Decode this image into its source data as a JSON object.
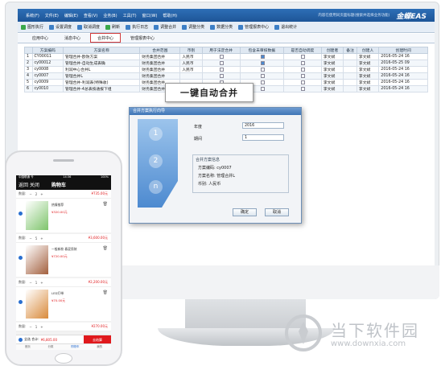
{
  "app": {
    "menu": [
      "系统(F)",
      "文件(E)",
      "编辑(E)",
      "查看(V)",
      "业务(B)",
      "工具(T)",
      "窗口(W)",
      "帮助(H)"
    ],
    "menu_hint": "内容在使用同页面标题(搜索并选择业务功能)",
    "logo": "金蝶EAS",
    "toolbar": [
      "图形执行",
      "设置调度",
      "取消调度",
      "刷新",
      "执行日志",
      "调整合并",
      "调整分类",
      "数据分类",
      "管理报表中心",
      "退出统计"
    ],
    "tabs": [
      "应用中心",
      "消息中心",
      "合并中心",
      "管理报表中心"
    ],
    "active_tab": "合并中心"
  },
  "grid": {
    "columns": [
      "",
      "方案编码",
      "方案名称",
      "合并范围",
      "币别",
      "用于法定合并",
      "包含未审核数据",
      "是否自动调度",
      "创建者",
      "备注",
      "创建人",
      "创建时间"
    ],
    "rows": [
      [
        "1",
        "CY00011",
        "管理合并-欧防方案",
        "财务集团合并",
        "人民币",
        false,
        true,
        false,
        "李文斌",
        "",
        "李文斌",
        "2016-05-24 16"
      ],
      [
        "2",
        "cy00012",
        "管理合并-自动生成表确",
        "财务集团合并",
        "人民币",
        false,
        true,
        false,
        "李文斌",
        "",
        "李文斌",
        "2016-05-25 09"
      ],
      [
        "3",
        "cy0008",
        "利润中心合并L",
        "财务集团合并",
        "人民币",
        false,
        false,
        false,
        "李文斌",
        "",
        "李文斌",
        "2016-05-24 16"
      ],
      [
        "4",
        "cy0007",
        "管理合并L",
        "财务集团合并",
        "",
        false,
        false,
        false,
        "李文斌",
        "",
        "李文斌",
        "2016-05-24 16"
      ],
      [
        "5",
        "cy0009",
        "管理合并-利润表(特殊收)",
        "财务集团合并",
        "",
        false,
        false,
        false,
        "李文斌",
        "",
        "李文斌",
        "2016-05-24 16"
      ],
      [
        "6",
        "cy0010",
        "管理合并-4总表按通报下组",
        "财务集团合并",
        "人民币",
        false,
        false,
        false,
        "李文斌",
        "",
        "李文斌",
        "2016-05-24 16"
      ]
    ]
  },
  "callout": "一键自动合并",
  "dialog": {
    "title": "合并方案执行向导",
    "year_label": "年度",
    "year_value": "2016",
    "period_label": "期间",
    "period_value": "1",
    "group_title": "合并方案信息",
    "scheme_code": "方案编码: cy0007",
    "scheme_name": "方案名称: 管理合并L",
    "currency": "币别: 人民币",
    "ok": "确定",
    "cancel": "取消",
    "steps": [
      "1",
      "2",
      "n"
    ]
  },
  "phone": {
    "status_left": "中国联通 令",
    "status_time": "14:36",
    "status_right": "100%",
    "back": "返回 关闭",
    "title": "购物车",
    "items": [
      {
        "qty_label": "数量:",
        "qty": "2",
        "sum": "¥735.00元",
        "name": "热情推荐",
        "price": "¥320.00元",
        "price2": "¥280.00元"
      },
      {
        "qty_label": "数量:",
        "qty": "5",
        "sum": "¥3,600.00元",
        "name": "一般新款 春夏男装",
        "price": "¥720.00元",
        "price2": ""
      },
      {
        "qty_label": "数量:",
        "qty": "1",
        "sum": "¥2,200.00元",
        "name": "LED灯带",
        "price": "¥70.00元",
        "price2": ""
      },
      {
        "qty_label": "数量:",
        "qty": "1",
        "sum": "¥270.00元",
        "name": "",
        "price": "",
        "price2": ""
      }
    ],
    "select_all": "全选 合计:",
    "total": "¥6,805.00",
    "checkout": "去结算",
    "nav": [
      "首页",
      "分类",
      "购物车",
      "我的"
    ]
  },
  "watermark": {
    "name": "当下软件园",
    "url": "www.downxia.com"
  }
}
